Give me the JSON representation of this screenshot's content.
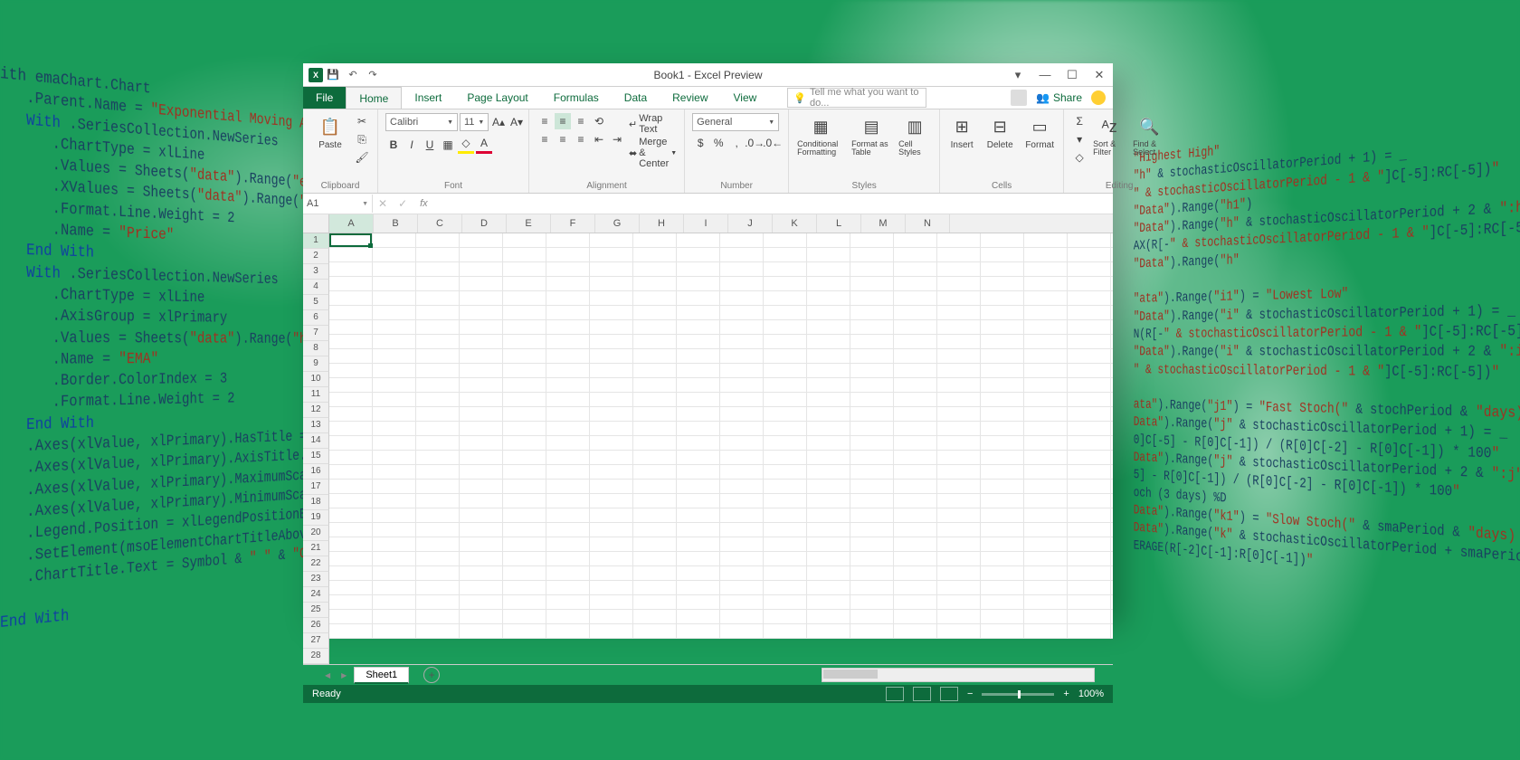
{
  "window": {
    "title": "Book1 - Excel Preview"
  },
  "tabs": [
    "File",
    "Home",
    "Insert",
    "Page Layout",
    "Formulas",
    "Data",
    "Review",
    "View"
  ],
  "active_tab": "Home",
  "tellme_placeholder": "Tell me what you want to do...",
  "share_label": "Share",
  "ribbon": {
    "clipboard": {
      "label": "Clipboard",
      "paste": "Paste"
    },
    "font": {
      "label": "Font",
      "name": "Calibri",
      "size": "11"
    },
    "alignment": {
      "label": "Alignment",
      "wrap": "Wrap Text",
      "merge": "Merge & Center"
    },
    "number": {
      "label": "Number",
      "format": "General"
    },
    "styles": {
      "label": "Styles",
      "cond": "Conditional Formatting",
      "table": "Format as Table",
      "cell": "Cell Styles"
    },
    "cells": {
      "label": "Cells",
      "insert": "Insert",
      "delete": "Delete",
      "format": "Format"
    },
    "editing": {
      "label": "Editing",
      "sort": "Sort & Filter",
      "find": "Find & Select"
    }
  },
  "namebox": "A1",
  "columns": [
    "A",
    "B",
    "C",
    "D",
    "E",
    "F",
    "G",
    "H",
    "I",
    "J",
    "K",
    "L",
    "M",
    "N"
  ],
  "rows_count": 28,
  "sheet": {
    "name": "Sheet1"
  },
  "status": {
    "ready": "Ready",
    "zoom": "100%"
  },
  "code_left": "ith emaChart.Chart\n   .Parent.Name = <str>\"Exponential Moving Avg. Chart\"</str>\n   <kw>With</kw> .SeriesCollection.NewSeries\n      .ChartType = xlLine\n      .Values = Sheets(<str>\"data\"</str>).Range(<str>\"e2:e\"</str> & rowCount)\n      .XValues = Sheets(<str>\"data\"</str>).Range(<str>\"a2:a\"</str> & rowCount)\n      .Format.Line.Weight = 2\n      .Name = <str>\"Price\"</str>\n   <kw>End With</kw>\n   <kw>With</kw> .SeriesCollection.NewSeries\n      .ChartType = xlLine\n      .AxisGroup = xlPrimary\n      .Values = Sheets(<str>\"data\"</str>).Range(<str>\"h2:h\"</str> & rowCount)\n      .Name = <str>\"EMA\"</str>\n      .Border.ColorIndex = 3\n      .Format.Line.Weight = 2\n   <kw>End With</kw>\n   .Axes(xlValue, xlPrimary).HasTitle = <kw>True</kw>\n   .Axes(xlValue, xlPrimary).AxisTitle.Characters.Text\n   .Axes(xlValue, xlPrimary).MaximumScale = Worksheet\n   .Axes(xlValue, xlPrimary).MinimumScale = Int(Works\n   .Legend.Position = xlLegendPositionBottom\n   .SetElement(msoElementChartTitleAboveChart)\n   .ChartTitle.Text = Symbol & <str>\" \"</str> & <str>\"Close Price vs \"</str>\n\n<kw>End With</kw>",
  "code_right": "<str>\"Highest High\"</str>\n<str>\"h\"</str> & stochasticOscillatorPeriod + 1) = _\n<str>\" & stochasticOscillatorPeriod - 1 & \"</str>]C[-5]:RC[-5])<str>\"</str>\n<str>\"Data\"</str>).Range(<str>\"h1\"</str>)\n<str>\"Data\"</str>).Range(<str>\"h\"</str> & stochasticOscillatorPeriod + 2 & <str>\":h\"</str> & r\nAX(R[-<str>\" & stochasticOscillatorPeriod - 1 & \"</str>]C[-5]:RC[-5])<str>\"</str>\n<str>\"Data\"</str>).Range(<str>\"h\"</str>\n\n<str>\"ata\"</str>).Range(<str>\"i1\"</str>) = <str>\"Lowest Low\"</str>\n<str>\"Data\"</str>).Range(<str>\"i\"</str> & stochasticOscillatorPeriod + 1) = _\nN(R[-<str>\" & stochasticOscillatorPeriod - 1 & \"</str>]C[-5]:RC[-5])<str>\"</str>\n<str>\"Data\"</str>).Range(<str>\"i\"</str> & stochasticOscillatorPeriod + 2 & <str>\":i\"</str> & r\n<str>\" & stochasticOscillatorPeriod - 1 & \"</str>]C[-5]:RC[-5])<str>\"</str>\n\n<str>ata\"</str>).Range(<str>\"j1\"</str>) = <str>\"Fast Stoch(\"</str> & stochPeriod & <str>\"days) %K</str>\n<str>Data\"</str>).Range(<str>\"j\"</str> & stochasticOscillatorPeriod + 1) = _\n0]C[-5] - R[0]C[-1]) / (R[0]C[-2] - R[0]C[-1]) * 100<str>\"</str>\n<str>Data\"</str>).Range(<str>\"j\"</str> & stochasticOscillatorPeriod + 2 & <str>\":j\"</str> & r\n5] - R[0]C[-1]) / (R[0]C[-2] - R[0]C[-1]) * 100<str>\"</str>\noch (3 days) %D\n<str>Data\"</str>).Range(<str>\"k1\"</str>) = <str>\"Slow Stoch(\"</str> & smaPeriod & <str>\"days) %D\"</str>\n<str>Data\"</str>).Range(<str>\"k\"</str> & stochasticOscillatorPeriod + smaPeriod)\nERAGE(R[-2]C[-1]:R[0]C[-1])<str>\"</str>"
}
